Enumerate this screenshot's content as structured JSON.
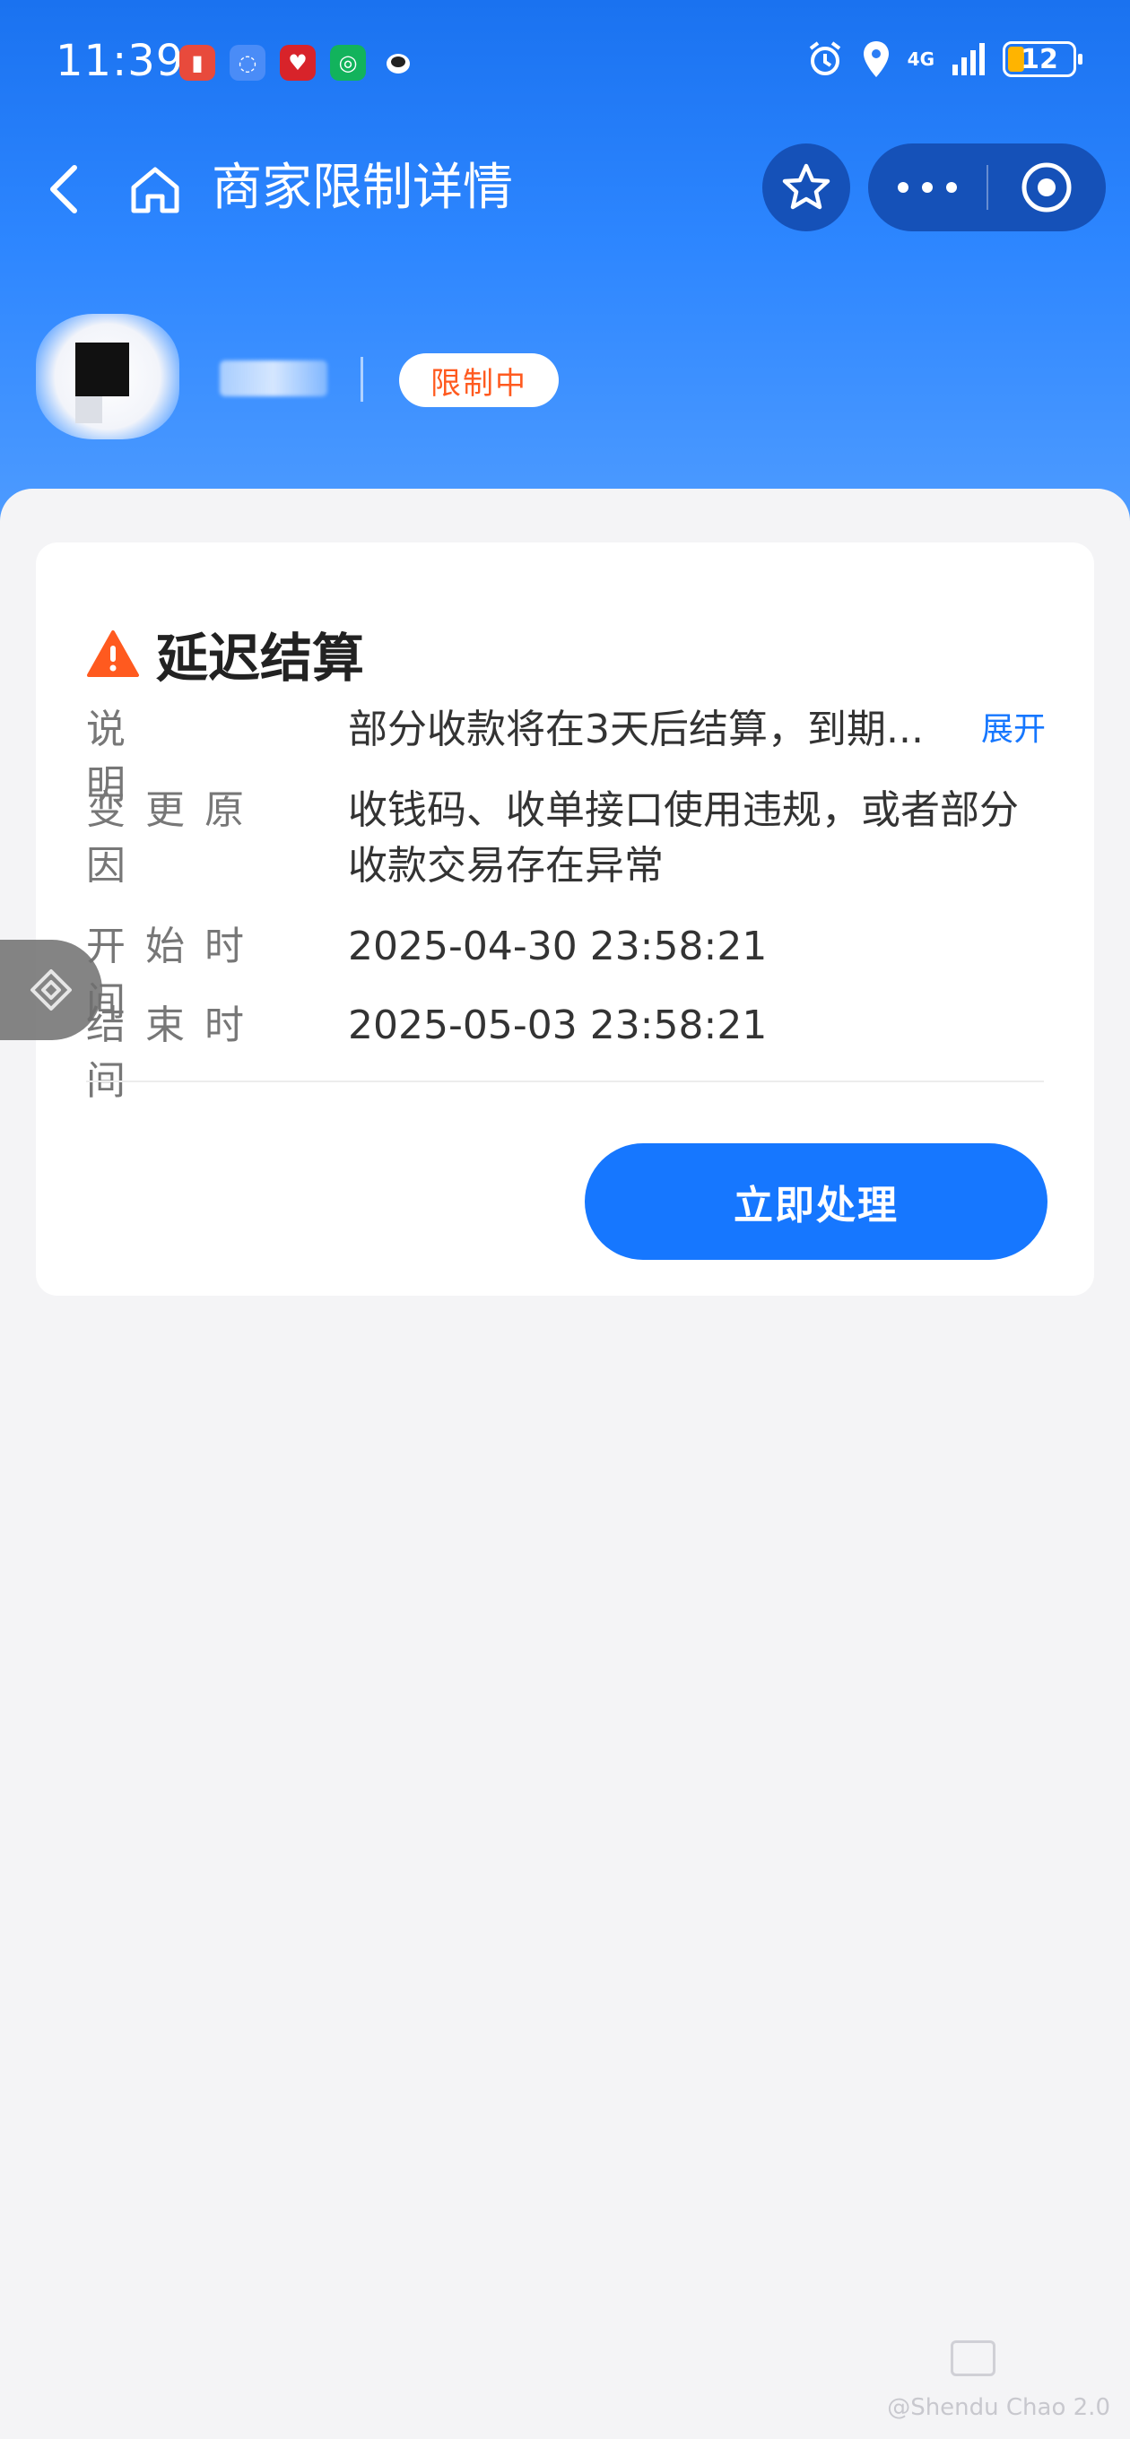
{
  "status_bar": {
    "time": "11:39",
    "battery": "12",
    "network": "4G",
    "notifications": [
      {
        "icon": "battery-alert-app-icon",
        "color": "#e84a3c"
      },
      {
        "icon": "chat-bubble-app-icon",
        "color": "#4a8cf7"
      },
      {
        "icon": "heart-app-icon",
        "color": "#d8232a"
      },
      {
        "icon": "green-app-icon",
        "color": "#12b35c"
      },
      {
        "icon": "robot-app-icon",
        "color": "#ffffff"
      }
    ]
  },
  "nav": {
    "title": "商家限制详情"
  },
  "merchant": {
    "status_badge": "限制中"
  },
  "card": {
    "title": "延迟结算",
    "rows": [
      {
        "label": "说明",
        "value": "部分收款将在3天后结算，到期...",
        "link": "展开"
      },
      {
        "label": "变更原因",
        "value": "收钱码、收单接口使用违规，或者部分收款交易存在异常"
      },
      {
        "label": "开始时间",
        "value": "2025-04-30 23:58:21"
      },
      {
        "label": "结束时间",
        "value": "2025-05-03 23:58:21"
      }
    ],
    "action_label": "立即处理"
  },
  "colors": {
    "header_blue": "#1a72f0",
    "primary": "#1677ff",
    "warning": "#ff5a1f"
  },
  "watermark": "@Shendu Chao 2.0"
}
